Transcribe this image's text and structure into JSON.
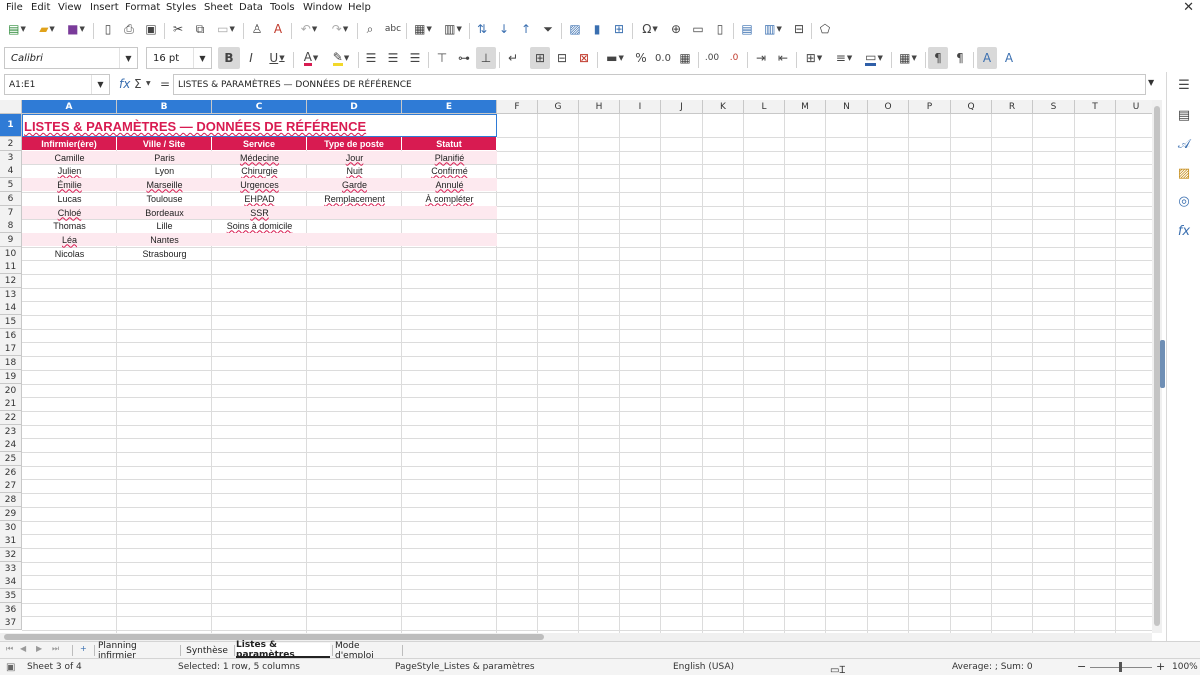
{
  "menu": [
    "File",
    "Edit",
    "View",
    "Insert",
    "Format",
    "Styles",
    "Sheet",
    "Data",
    "Tools",
    "Window",
    "Help"
  ],
  "toolbar": {
    "font_name": "Calibri",
    "font_size": "16 pt",
    "bold": "B",
    "italic": "I",
    "underline": "U",
    "font_color_glyph": "A",
    "percent": "%",
    "decimal_zero": "0.0",
    "add_decimal": ".00",
    "del_decimal": ".0"
  },
  "formula_bar": {
    "name_box": "A1:E1",
    "content": "LISTES & PARAMÈTRES — DONNÉES DE RÉFÉRENCE",
    "fx": "fx",
    "sum": "Σ",
    "equals": "="
  },
  "columns": [
    "A",
    "B",
    "C",
    "D",
    "E",
    "F",
    "G",
    "H",
    "I",
    "J",
    "K",
    "L",
    "M",
    "N",
    "O",
    "P",
    "Q",
    "R",
    "S",
    "T",
    "U"
  ],
  "rows": [
    "1",
    "2",
    "3",
    "4",
    "5",
    "6",
    "7",
    "8",
    "9",
    "10",
    "11",
    "12",
    "13",
    "14",
    "15",
    "16",
    "17",
    "18",
    "19",
    "20",
    "21",
    "22",
    "23",
    "24",
    "25",
    "26",
    "27",
    "28",
    "29",
    "30",
    "31",
    "32",
    "33",
    "34",
    "35",
    "36",
    "37"
  ],
  "sheet": {
    "title": "LISTES & PARAMÈTRES — DONNÉES DE RÉFÉRENCE",
    "headers": [
      "Infirmier(ère)",
      "Ville / Site",
      "Service",
      "Type de poste",
      "Statut"
    ],
    "data": [
      [
        "Camille",
        "Paris",
        "Médecine",
        "Jour",
        "Planifié"
      ],
      [
        "Julien",
        "Lyon",
        "Chirurgie",
        "Nuit",
        "Confirmé"
      ],
      [
        "Émilie",
        "Marseille",
        "Urgences",
        "Garde",
        "Annulé"
      ],
      [
        "Lucas",
        "Toulouse",
        "EHPAD",
        "Remplacement",
        "À compléter"
      ],
      [
        "Chloé",
        "Bordeaux",
        "SSR",
        "",
        ""
      ],
      [
        "Thomas",
        "Lille",
        "Soins à domicile",
        "",
        ""
      ],
      [
        "Léa",
        "Nantes",
        "",
        "",
        ""
      ],
      [
        "Nicolas",
        "Strasbourg",
        "",
        "",
        ""
      ]
    ],
    "colors": {
      "accent": "#d81b51",
      "band": "#fde9ef",
      "selection": "#2f7bd6"
    }
  },
  "tabs": [
    "Planning infirmier",
    "Synthèse",
    "Listes & paramètres",
    "Mode d'emploi"
  ],
  "active_tab": "Listes & paramètres",
  "status": {
    "sheet": "Sheet 3 of 4",
    "selection": "Selected: 1 row, 5 columns",
    "page_style": "PageStyle_Listes & paramètres",
    "language": "English (USA)",
    "stats": "Average: ; Sum: 0",
    "zoom": "100%"
  }
}
